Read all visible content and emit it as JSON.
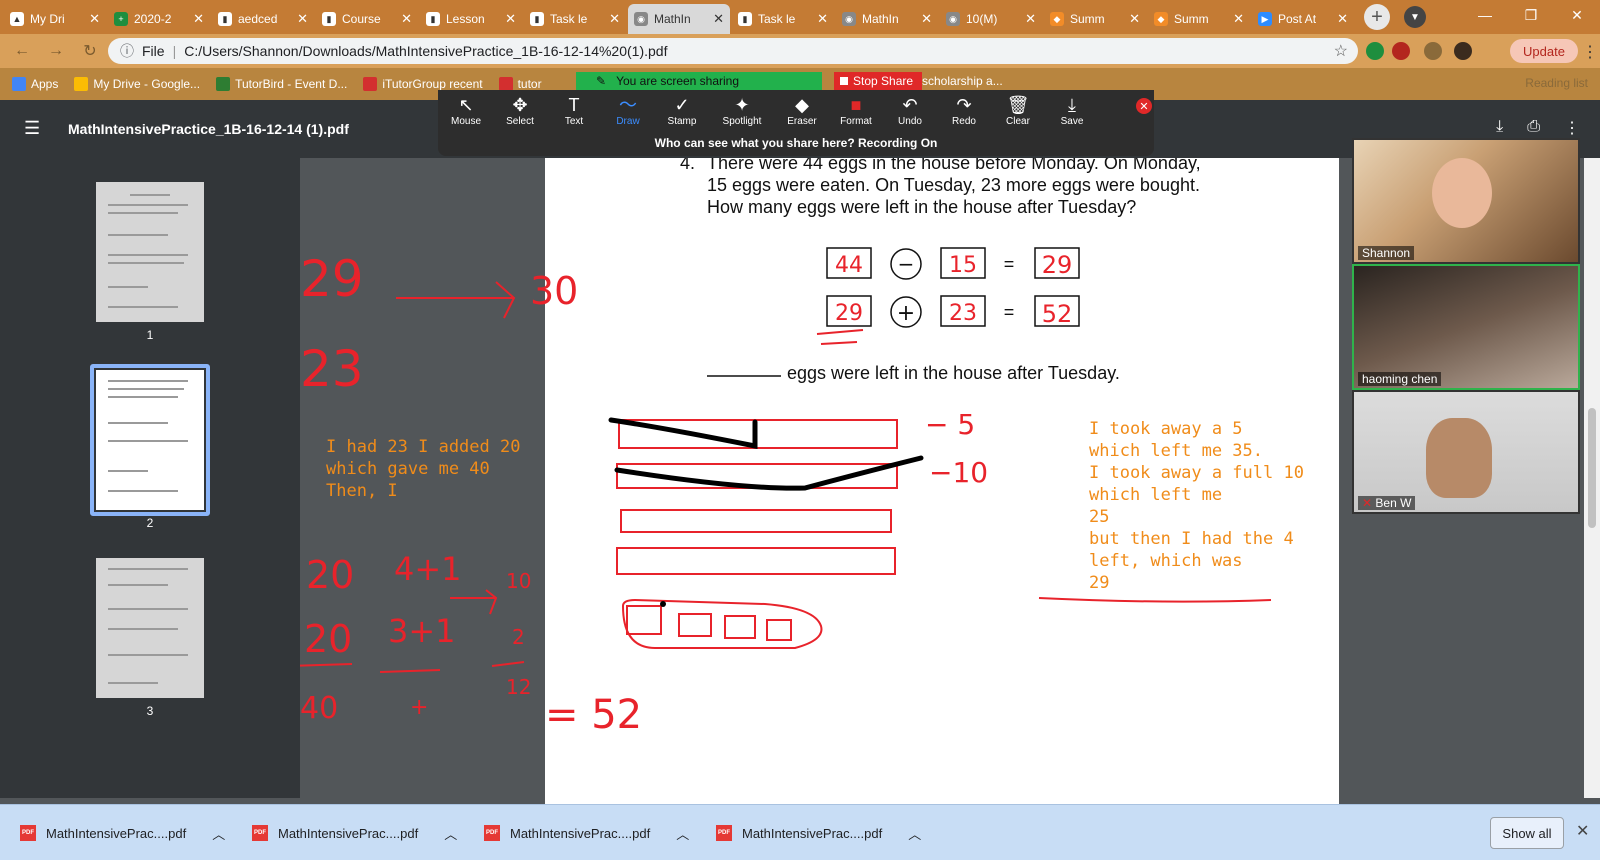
{
  "browser": {
    "tabs": [
      {
        "label": "My Dri",
        "active": false
      },
      {
        "label": "2020-2",
        "active": false
      },
      {
        "label": "aedced",
        "active": false
      },
      {
        "label": "Course",
        "active": false
      },
      {
        "label": "Lesson",
        "active": false
      },
      {
        "label": "Task le",
        "active": false
      },
      {
        "label": "MathIn",
        "active": true
      },
      {
        "label": "Task le",
        "active": false
      },
      {
        "label": "MathIn",
        "active": false
      },
      {
        "label": "10(M)",
        "active": false
      },
      {
        "label": "Summ",
        "active": false
      },
      {
        "label": "Summ",
        "active": false
      },
      {
        "label": "Post At",
        "active": false
      }
    ],
    "new_tab": "+",
    "address": {
      "prefix": "File",
      "url": "C:/Users/Shannon/Downloads/MathIntensivePractice_1B-16-12-14%20(1).pdf"
    },
    "update_label": "Update",
    "reading_list": "Reading list",
    "bookmarks": [
      "Apps",
      "My Drive - Google...",
      "TutorBird - Event D...",
      "iTutorGroup recent",
      "tutor"
    ]
  },
  "zoom": {
    "banner": "You are screen sharing",
    "stop_share": "Stop Share",
    "behind_text": "scholarship a...",
    "tools": [
      "Mouse",
      "Select",
      "Text",
      "Draw",
      "Stamp",
      "Spotlight",
      "Eraser",
      "Format",
      "Undo",
      "Redo",
      "Clear",
      "Save"
    ],
    "tool_icons": [
      "↖",
      "✥",
      "T",
      "〜",
      "✓",
      "✦",
      "◆",
      "■",
      "↶",
      "↷",
      "🗑",
      "⤓"
    ],
    "who_can_see": "Who can see what you share here? Recording On",
    "participants": [
      "Shannon",
      "haoming   chen",
      "Ben W"
    ]
  },
  "pdf": {
    "title": "MathIntensivePractice_1B-16-12-14 (1).pdf",
    "pages": [
      "1",
      "2",
      "3"
    ],
    "question": {
      "number": "4.",
      "lines": [
        "There were 44 eggs in the house before Monday. On Monday,",
        "15 eggs were eaten. On Tuesday, 23 more eggs were bought.",
        "How many eggs were left in the house after Tuesday?"
      ],
      "eq1": {
        "a": "44",
        "op": "−",
        "b": "15",
        "eq": "=",
        "r": "29"
      },
      "eq2": {
        "a": "29",
        "op": "+",
        "b": "23",
        "eq": "=",
        "r": "52"
      },
      "answer_line": "eggs were left in the house after Tuesday."
    },
    "annotations": {
      "left_top": [
        "29",
        "30",
        "23"
      ],
      "left_note": [
        "I had 23 I added 20",
        "which gave me 40",
        "Then, I"
      ],
      "left_work": [
        "20",
        "4+1",
        "10",
        "20",
        "3+1",
        "2",
        "40",
        "+",
        "12",
        "= 52"
      ],
      "bar_labels": [
        "− 5",
        "−10"
      ],
      "right_note": [
        "I took away a 5",
        "which left me 35.",
        "I took away a full 10",
        "which left me",
        "25",
        "but then I had the 4",
        "left, which was",
        "29"
      ]
    }
  },
  "downloads": {
    "items": [
      "MathIntensivePrac....pdf",
      "MathIntensivePrac....pdf",
      "MathIntensivePrac....pdf",
      "MathIntensivePrac....pdf"
    ],
    "show_all": "Show all"
  },
  "colors": {
    "annotation_red": "#e8232b",
    "annotation_orange": "#f08c1a",
    "chrome_orange": "#c47b34"
  }
}
